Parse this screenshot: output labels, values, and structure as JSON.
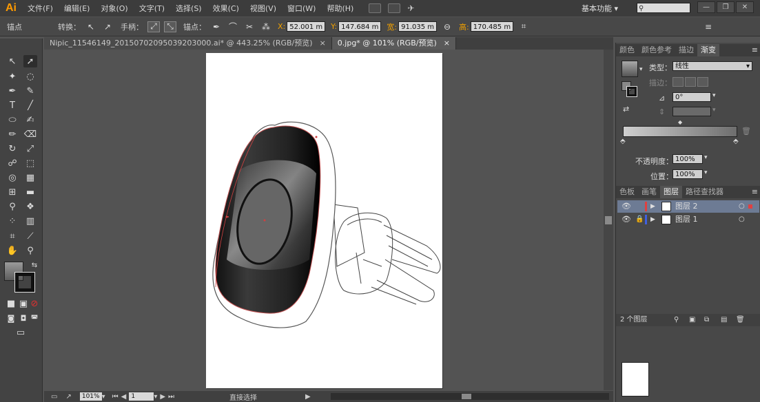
{
  "menubar": {
    "logo": "Ai",
    "items": [
      "文件(F)",
      "编辑(E)",
      "对象(O)",
      "文字(T)",
      "选择(S)",
      "效果(C)",
      "视图(V)",
      "窗口(W)",
      "帮助(H)"
    ],
    "workspace": "基本功能",
    "window_buttons": [
      "—",
      "❐",
      "✕"
    ]
  },
  "controlbar": {
    "mode_label": "锚点",
    "convert_label": "转换：",
    "handles_label": "手柄：",
    "anchor_label": "锚点：",
    "x_label": "X:",
    "x_value": "52.001 m",
    "y_label": "Y:",
    "y_value": "147.684 m",
    "w_label": "宽:",
    "w_value": "91.035 m",
    "h_label": "高:",
    "h_value": "170.485 m"
  },
  "tabs": [
    {
      "label": "Nipic_11546149_20150702095039203000.ai* @ 443.25% (RGB/预览)",
      "active": false
    },
    {
      "label": "0.jpg* @ 101% (RGB/预览)",
      "active": true
    }
  ],
  "tab_close": "×",
  "statusbar": {
    "zoom": "101%",
    "page": "1",
    "tool": "直接选择"
  },
  "gradient_panel": {
    "tabs": [
      "颜色",
      "颜色参考",
      "描边",
      "渐变"
    ],
    "active_tab": "渐变",
    "type_label": "类型：",
    "type_value": "线性",
    "stroke_label": "描边：",
    "angle_value": "0°",
    "opacity_label": "不透明度：",
    "opacity_value": "100%",
    "location_label": "位置：",
    "location_value": "100%"
  },
  "layers_panel": {
    "tabs": [
      "色板",
      "画笔",
      "图层",
      "路径查找器"
    ],
    "active_tab": "图层",
    "layers": [
      {
        "name": "图层 2",
        "color": "#e04040",
        "selected": true,
        "locked": false
      },
      {
        "name": "图层 1",
        "color": "#4060e0",
        "selected": false,
        "locked": true
      }
    ],
    "count_label": "2 个图层"
  },
  "colors": {
    "accent_orange": "#f0a000",
    "selection_blue": "#6d7b94",
    "path_red": "#d04040"
  }
}
